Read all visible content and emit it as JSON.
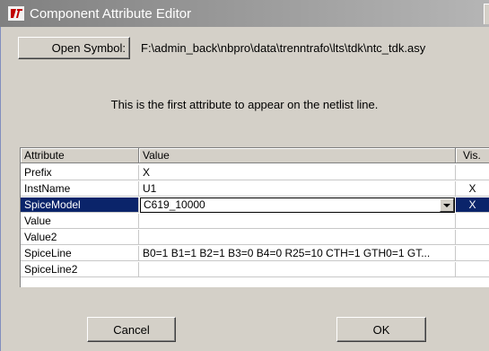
{
  "window": {
    "title": "Component Attribute Editor",
    "icon": "ltspice-logo-icon"
  },
  "open_symbol": {
    "label": "Open Symbol:",
    "path": "F:\\admin_back\\nbpro\\data\\trenntrafo\\lts\\tdk\\ntc_tdk.asy"
  },
  "hint": "This is the first attribute to appear on the netlist line.",
  "table": {
    "headers": {
      "attribute": "Attribute",
      "value": "Value",
      "visible": "Vis."
    },
    "rows": [
      {
        "attribute": "Prefix",
        "value": "X",
        "visible": ""
      },
      {
        "attribute": "InstName",
        "value": "U1",
        "visible": "X"
      },
      {
        "attribute": "SpiceModel",
        "value": "C619_10000",
        "visible": "X"
      },
      {
        "attribute": "Value",
        "value": "",
        "visible": ""
      },
      {
        "attribute": "Value2",
        "value": "",
        "visible": ""
      },
      {
        "attribute": "SpiceLine",
        "value": "B0=1 B1=1 B2=1 B3=0 B4=0 R25=10 CTH=1 GTH0=1 GT...",
        "visible": ""
      },
      {
        "attribute": "SpiceLine2",
        "value": "",
        "visible": ""
      }
    ]
  },
  "buttons": {
    "cancel": "Cancel",
    "ok": "OK"
  },
  "colors": {
    "selection": "#0a246a",
    "titlebar_start": "#808080",
    "titlebar_end": "#b5b5b5",
    "logo": "#c00000"
  }
}
